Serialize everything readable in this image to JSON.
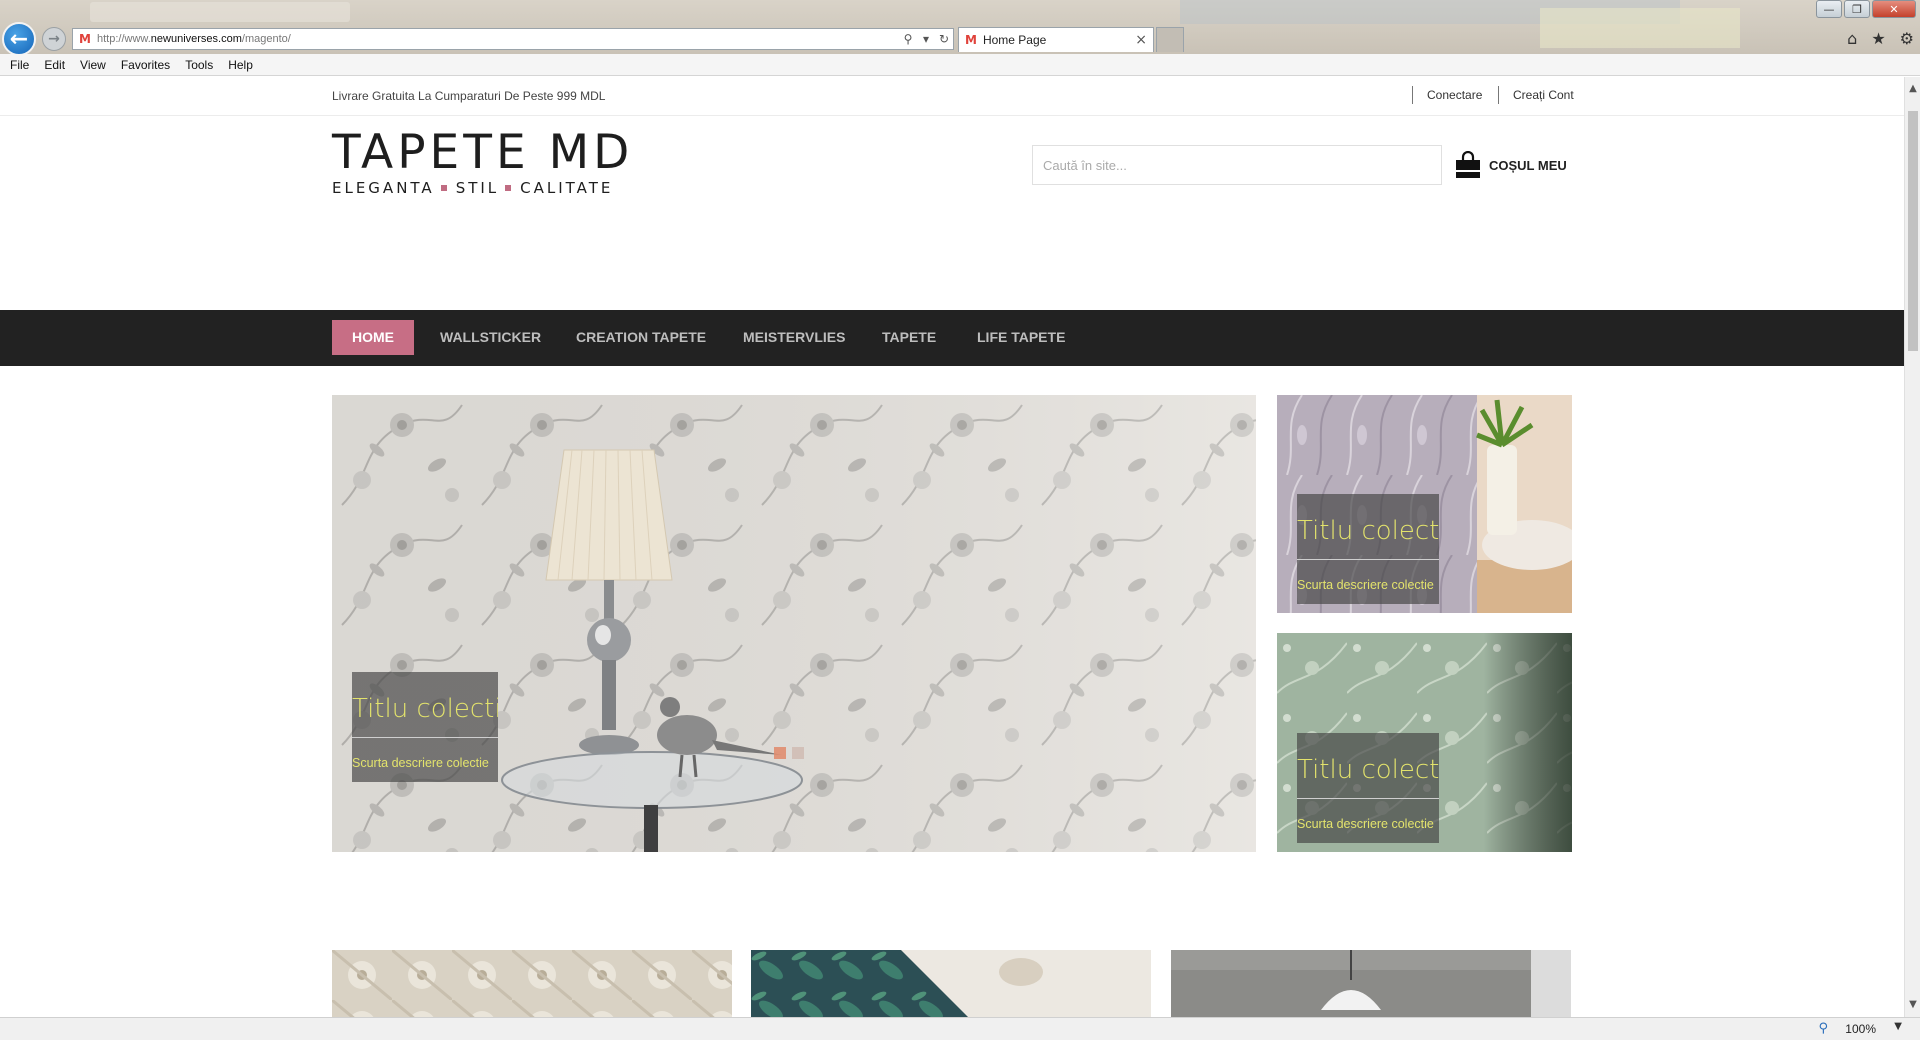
{
  "browser": {
    "url_prefix": "http://www.",
    "url_domain": "newuniverses.com",
    "url_path": "/magento/",
    "tab_title": "Home Page",
    "tab_close": "×",
    "menu": [
      "File",
      "Edit",
      "View",
      "Favorites",
      "Tools",
      "Help"
    ],
    "zoom": "100%",
    "icons": {
      "back": "back-arrow-icon",
      "forward": "forward-arrow-icon",
      "search": "search-icon",
      "refresh": "refresh-icon",
      "home": "home-icon",
      "favorites": "star-icon",
      "settings": "gear-icon"
    }
  },
  "site": {
    "promo": "Livrare Gratuita La Cumparaturi De Peste 999 MDL",
    "account": {
      "login": "Conectare",
      "register": "Creați Cont"
    },
    "logo": {
      "title": "TAPETE MD",
      "tagline": [
        "ELEGANTA",
        "STIL",
        "CALITATE"
      ]
    },
    "search_placeholder": "Caută în site...",
    "cart_label": "COȘUL MEU",
    "nav": [
      "HOME",
      "WALLSTICKER",
      "CREATION TAPETE",
      "MEISTERVLIES",
      "TAPETE",
      "LIFE TAPETE"
    ],
    "main_slide": {
      "title": "Titlu colectie",
      "description": "Scurta descriere colectie"
    },
    "side_banners": [
      {
        "title": "Titlu colectie",
        "description": "Scurta descriere colectie"
      },
      {
        "title": "Titlu colectie",
        "description": "Scurta descriere colectie"
      }
    ],
    "colors": {
      "nav_bg": "#222222",
      "nav_active": "#c76e85",
      "logo_dot": "#c06c82",
      "caption_text": "#e3e36c"
    }
  }
}
